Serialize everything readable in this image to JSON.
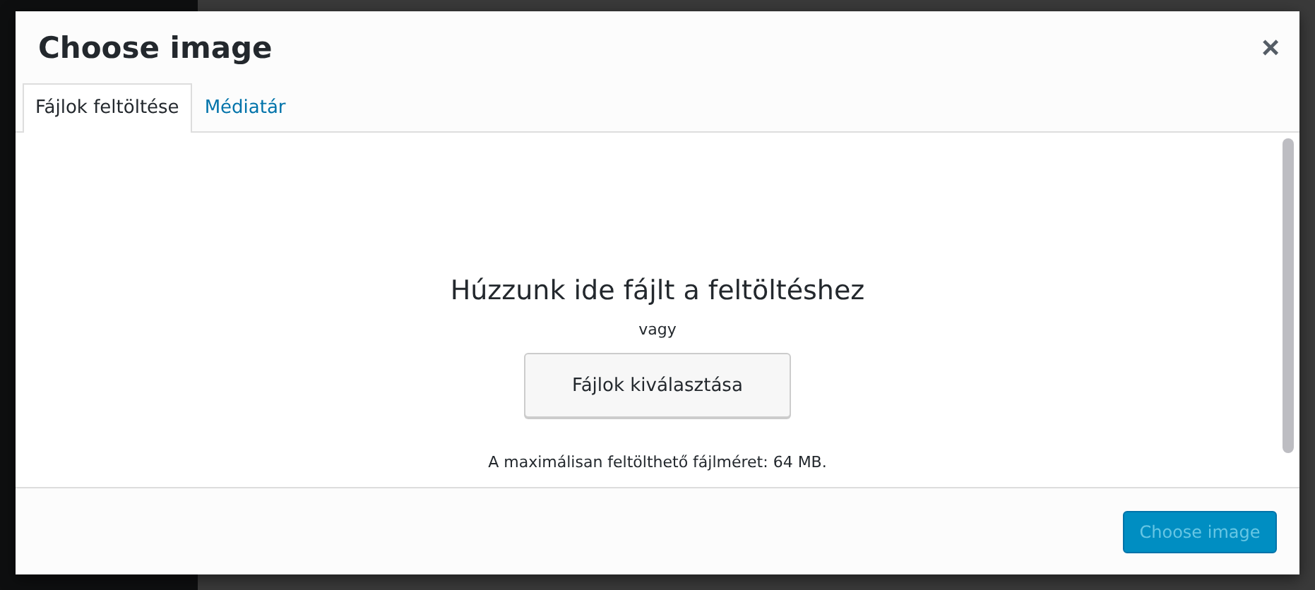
{
  "modal": {
    "title": "Choose image",
    "close": "×"
  },
  "tabs": [
    {
      "label": "Fájlok feltöltése",
      "selected": true
    },
    {
      "label": "Médiatár",
      "selected": false
    }
  ],
  "upload": {
    "heading": "Húzzunk ide fájlt a feltöltéshez",
    "or": "vagy",
    "button": "Fájlok kiválasztása",
    "max_size": "A maximálisan feltölthető fájlméret: 64 MB."
  },
  "footer": {
    "button": {
      "label": "Choose image",
      "disabled": true
    }
  }
}
